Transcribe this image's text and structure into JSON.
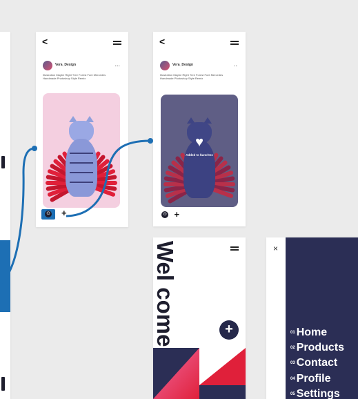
{
  "screen_detail": {
    "username": "Vera_Design",
    "caption": "Illustration Maybe Right Tree Forest Font Mercedes Handmade Photoshop Style Remix",
    "more_label": "...",
    "back_label": "<"
  },
  "screen_added": {
    "username": "Vera_Design",
    "caption": "Illustration Maybe Right Tree Forest Font Mercedes Handmade Photoshop Style Remix",
    "more_label": "..",
    "added_label": "Added to favorites"
  },
  "welcome_screen": {
    "title": "Wel come.",
    "fab_label": "+"
  },
  "menu_screen": {
    "close_label": "×",
    "items": [
      {
        "num": "01",
        "label": "Home"
      },
      {
        "num": "02",
        "label": "Products"
      },
      {
        "num": "03",
        "label": "Contact"
      },
      {
        "num": "04",
        "label": "Profile"
      },
      {
        "num": "05",
        "label": "Settings"
      }
    ]
  },
  "icons": {
    "nav_back": "chevron-left-icon",
    "menu": "hamburger-menu-icon",
    "comment": "comment-icon",
    "add": "plus-icon",
    "heart": "heart-icon",
    "close": "close-icon"
  },
  "colors": {
    "canvas": "#ebebeb",
    "connector": "#1d6fb4",
    "navy": "#2b2e55",
    "pink_card": "#f4cfe0",
    "purple_card": "#5f5e85",
    "accent_red": "#e0203a"
  }
}
